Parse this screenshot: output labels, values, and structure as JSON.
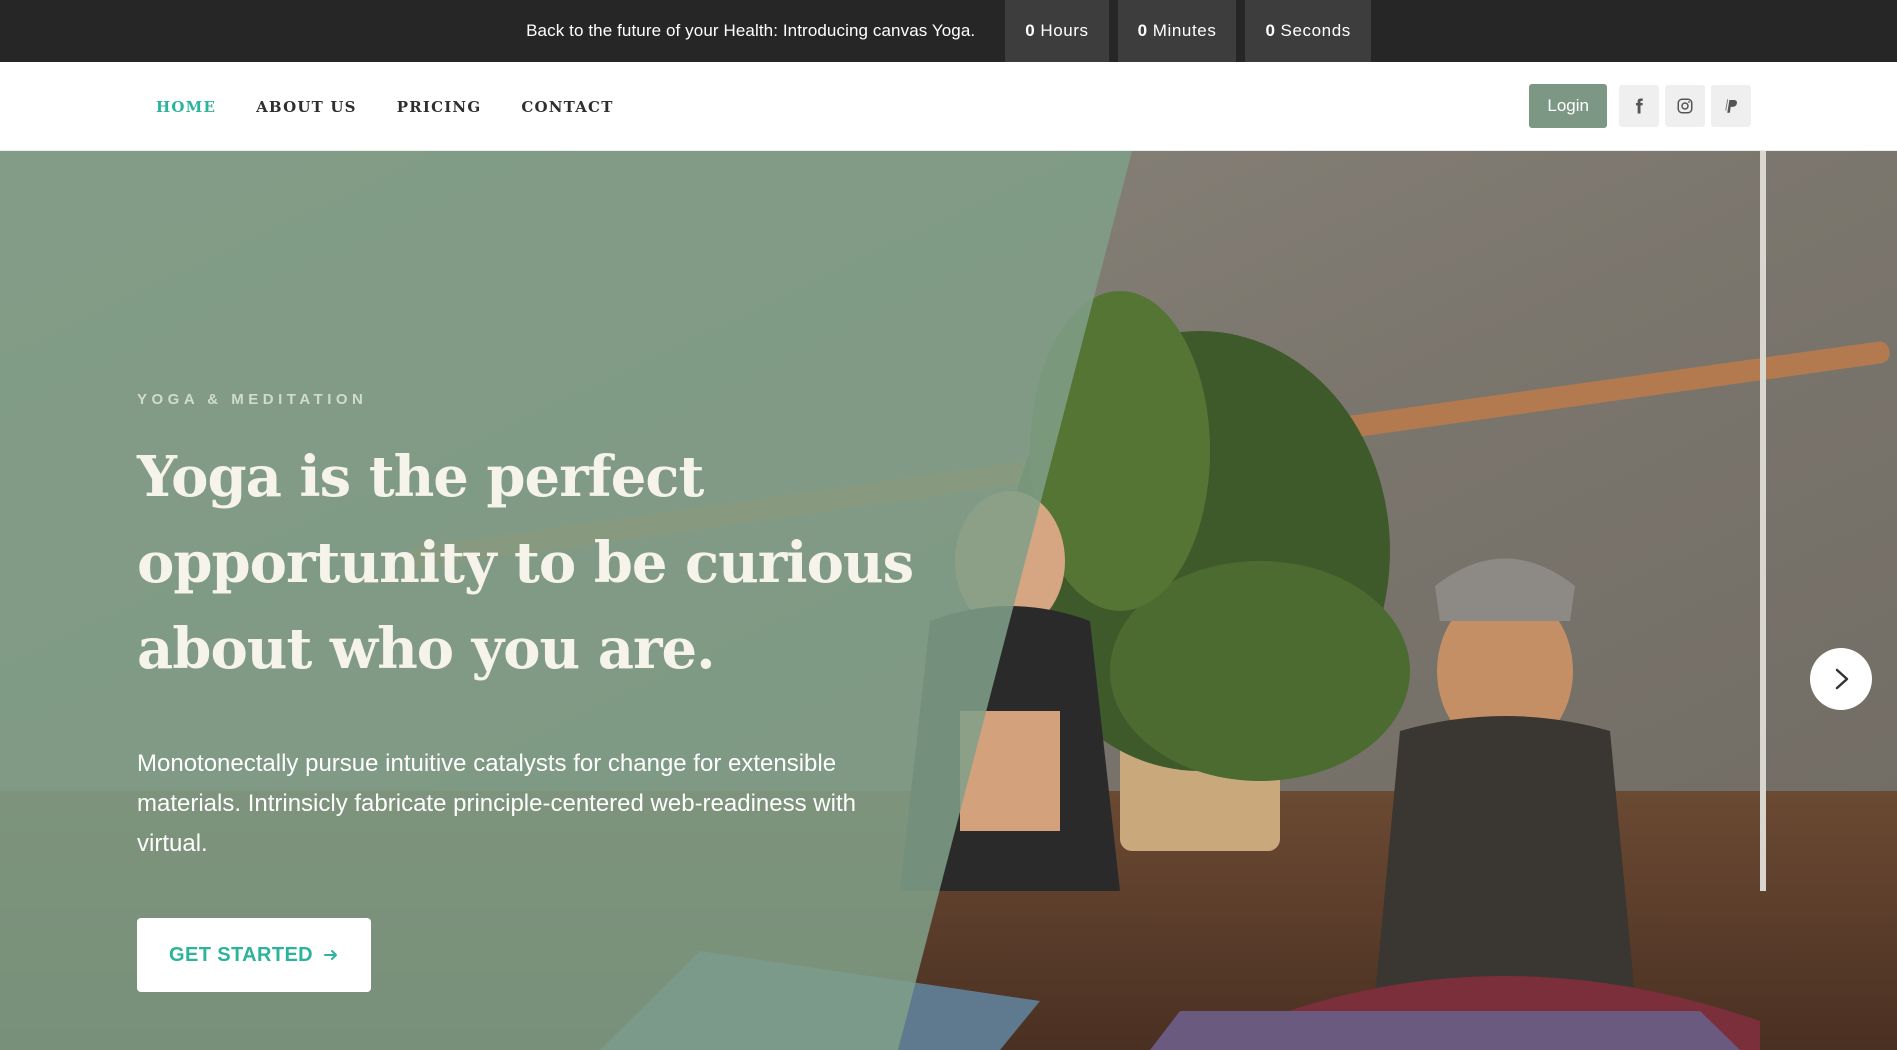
{
  "topbar": {
    "announcement": "Back to the future of your Health: Introducing canvas Yoga.",
    "countdown": [
      {
        "value": "0",
        "unit": "Hours"
      },
      {
        "value": "0",
        "unit": "Minutes"
      },
      {
        "value": "0",
        "unit": "Seconds"
      }
    ]
  },
  "nav": {
    "items": [
      {
        "label": "HOME",
        "active": true
      },
      {
        "label": "ABOUT US"
      },
      {
        "label": "PRICING"
      },
      {
        "label": "CONTACT"
      }
    ],
    "login_label": "Login",
    "social_icons": [
      "facebook-icon",
      "instagram-icon",
      "paypal-icon"
    ]
  },
  "hero": {
    "eyebrow": "YOGA & MEDITATION",
    "title": "Yoga is the perfect opportunity to be curious about who you are.",
    "description": "Monotonectally pursue intuitive catalysts for change for extensible materials. Intrinsicly fabricate principle-centered web-readiness with virtual.",
    "cta_label": "GET STARTED",
    "cta_icon": "arrow-right-icon",
    "next_icon": "chevron-right-icon"
  },
  "colors": {
    "topbar_bg": "#262626",
    "accent": "#2bb39b",
    "login_bg": "#7c9884",
    "overlay": "#80a088"
  }
}
